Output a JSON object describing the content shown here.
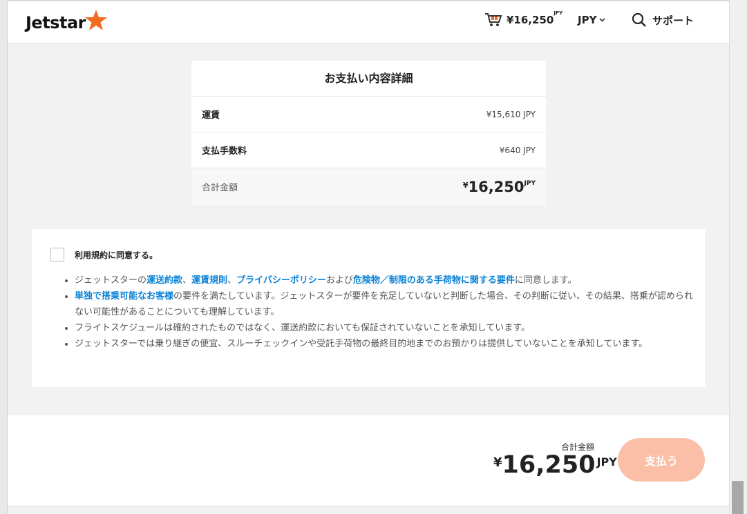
{
  "header": {
    "logo_text": "Jetstar",
    "cart_amount": "¥16,250",
    "cart_currency": "JPY",
    "currency_selector": "JPY",
    "support_label": "サポート",
    "brand_color": "#f26b21"
  },
  "summary": {
    "title": "お支払い内容詳細",
    "rows": [
      {
        "label": "運賃",
        "value": "¥15,610 JPY"
      },
      {
        "label": "支払手数料",
        "value": "¥640 JPY"
      }
    ],
    "total_label": "合計金額",
    "total_yen": "¥",
    "total_amount": "16,250",
    "total_currency": "JPY"
  },
  "terms": {
    "agree_label": "利用規約に同意する。",
    "b1": {
      "t1": "ジェットスターの",
      "l1": "運送約款",
      "t2": "、",
      "l2": "運賃規則",
      "t3": "、",
      "l3": "プライバシーポリシー",
      "t4": "および",
      "l4": "危険物／制限のある手荷物に関する要件",
      "t5": "に同意します。"
    },
    "b2": {
      "l1": "単独で搭乗可能なお客様",
      "t1": "の要件を満たしています。ジェットスターが要件を充足していないと判断した場合、その判断に従い、その結果、搭乗が認められない可能性があることについても理解しています。"
    },
    "b3": "フライトスケジュールは確約されたものではなく、運送約款においても保証されていないことを承知しています。",
    "b4": "ジェットスターでは乗り継ぎの便宜、スルーチェックインや受託手荷物の最終目的地までのお預かりは提供していないことを承知しています。",
    "link_color": "#0a82d6"
  },
  "footer": {
    "total_label": "合計金額",
    "total_yen": "¥",
    "total_amount": "16,250",
    "total_currency": "JPY",
    "pay_button": "支払う",
    "pay_button_color": "#fbbfa7"
  }
}
